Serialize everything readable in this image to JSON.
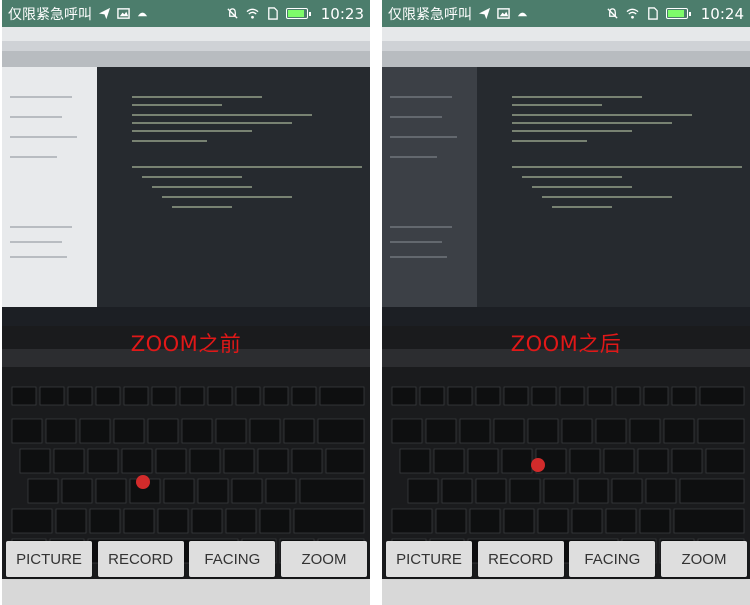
{
  "status_bar": {
    "carrier": "仅限紧急呼叫",
    "icons_left": [
      "send-icon",
      "image-icon",
      "android-icon"
    ],
    "icons_right": [
      "mute-icon",
      "wifi-icon",
      "sim-icon",
      "battery-icon"
    ]
  },
  "panels": [
    {
      "time": "10:23",
      "caption": "ZOOM之前"
    },
    {
      "time": "10:24",
      "caption": "ZOOM之后"
    }
  ],
  "buttons": {
    "picture": "PICTURE",
    "record": "RECORD",
    "facing": "FACING",
    "zoom": "ZOOM"
  },
  "colors": {
    "status_bar": "#4c7d6c",
    "caption": "#e01818",
    "button_bg": "#dedede"
  }
}
